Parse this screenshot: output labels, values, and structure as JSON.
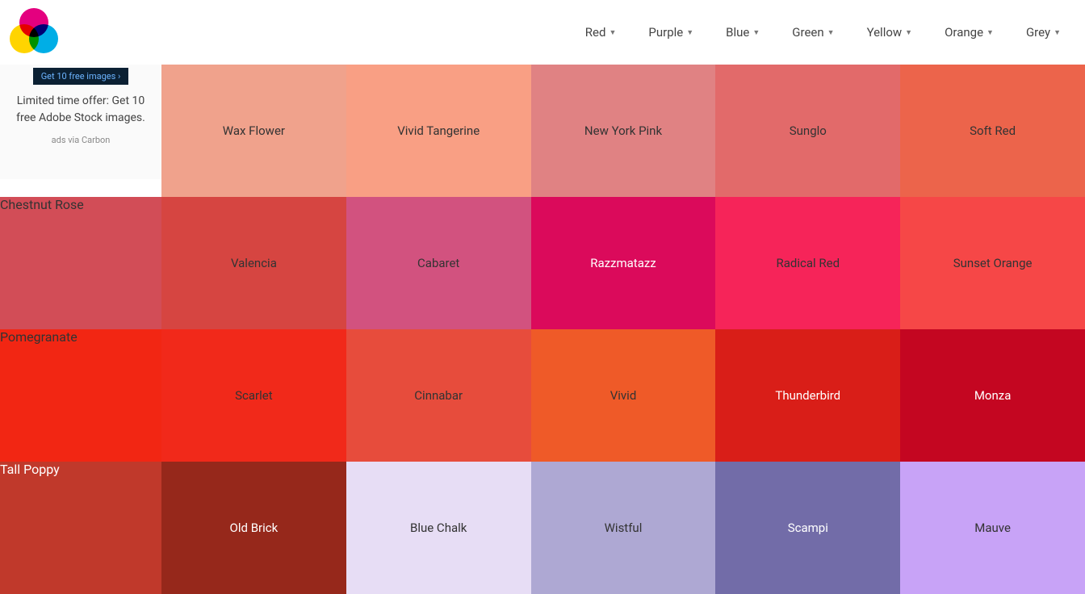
{
  "nav": {
    "items": [
      "Red",
      "Purple",
      "Blue",
      "Green",
      "Yellow",
      "Orange",
      "Grey"
    ]
  },
  "ad": {
    "badge": "Get 10 free images ›",
    "text": "Limited time offer: Get 10 free Adobe Stock images.",
    "via": "ads via Carbon"
  },
  "rows": [
    [
      {
        "name": "Wax Flower",
        "hex": "#f0a28c",
        "text": "dark"
      },
      {
        "name": "Vivid Tangerine",
        "hex": "#f99f84",
        "text": "dark"
      },
      {
        "name": "New York Pink",
        "hex": "#e08283",
        "text": "dark"
      },
      {
        "name": "Sunglo",
        "hex": "#e26a6a",
        "text": "dark"
      },
      {
        "name": "Soft Red",
        "hex": "#ec644b",
        "text": "dark"
      }
    ],
    [
      {
        "name": "Chestnut Rose",
        "hex": "#d24d57",
        "text": "dark"
      },
      {
        "name": "Valencia",
        "hex": "#d64541",
        "text": "dark"
      },
      {
        "name": "Cabaret",
        "hex": "#d2527f",
        "text": "dark"
      },
      {
        "name": "Razzmatazz",
        "hex": "#db0a5b",
        "text": "light"
      },
      {
        "name": "Radical Red",
        "hex": "#f62459",
        "text": "dark"
      },
      {
        "name": "Sunset Orange",
        "hex": "#f64747",
        "text": "dark"
      }
    ],
    [
      {
        "name": "Pomegranate",
        "hex": "#f22613",
        "text": "dark"
      },
      {
        "name": "Scarlet",
        "hex": "#f1291a",
        "text": "dark"
      },
      {
        "name": "Cinnabar",
        "hex": "#e74c3c",
        "text": "dark"
      },
      {
        "name": "Vivid",
        "hex": "#ef5a28",
        "text": "dark"
      },
      {
        "name": "Thunderbird",
        "hex": "#d91e18",
        "text": "light"
      },
      {
        "name": "Monza",
        "hex": "#c40621",
        "text": "light"
      }
    ],
    [
      {
        "name": "Tall Poppy",
        "hex": "#c0392b",
        "text": "light"
      },
      {
        "name": "Old Brick",
        "hex": "#96281b",
        "text": "light"
      },
      {
        "name": "Blue Chalk",
        "hex": "#e7ddf5",
        "text": "dark"
      },
      {
        "name": "Wistful",
        "hex": "#aea8d3",
        "text": "dark"
      },
      {
        "name": "Scampi",
        "hex": "#726ca8",
        "text": "light"
      },
      {
        "name": "Mauve",
        "hex": "#c8a3f7",
        "text": "dark"
      }
    ]
  ]
}
